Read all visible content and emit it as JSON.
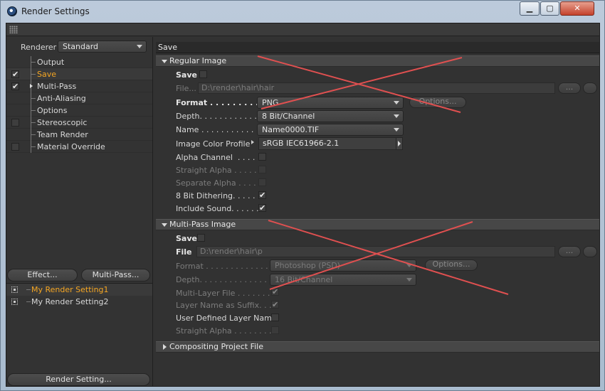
{
  "window": {
    "title": "Render Settings",
    "min_label": "▁",
    "max_label": "▢",
    "close_label": "✕"
  },
  "renderer": {
    "label": "Renderer",
    "value": "Standard"
  },
  "tree": [
    {
      "label": "Output",
      "checkbox": false,
      "checked": false,
      "selected": false
    },
    {
      "label": "Save",
      "checkbox": true,
      "checked": true,
      "selected": true
    },
    {
      "label": "Multi-Pass",
      "checkbox": true,
      "checked": true,
      "selected": false
    },
    {
      "label": "Anti-Aliasing",
      "checkbox": false,
      "checked": false,
      "selected": false
    },
    {
      "label": "Options",
      "checkbox": false,
      "checked": false,
      "selected": false
    },
    {
      "label": "Stereoscopic",
      "checkbox": true,
      "checked": false,
      "selected": false
    },
    {
      "label": "Team Render",
      "checkbox": false,
      "checked": false,
      "selected": false
    },
    {
      "label": "Material Override",
      "checkbox": true,
      "checked": false,
      "selected": false
    }
  ],
  "buttons": {
    "effect": "Effect...",
    "multipass": "Multi-Pass...",
    "render_setting": "Render Setting..."
  },
  "presets": [
    {
      "label": "My Render Setting1",
      "active": true
    },
    {
      "label": "My Render Setting2",
      "active": false
    }
  ],
  "panel": {
    "title": "Save"
  },
  "regular": {
    "title": "Regular Image",
    "save_label": "Save",
    "file_label": "File...",
    "file_value": "D:\\render\\hair\\hair",
    "dots_btn": "...",
    "format_label": "Format . . . . . . . . . . . . .",
    "format_value": "PNG",
    "options_btn": "Options...",
    "depth_label": "Depth. . . . . . . . . . . . . . .",
    "depth_value": "8 Bit/Channel",
    "name_label": "Name . . . . . . . . . . . . . . .",
    "name_value": "Name0000.TIF",
    "profile_label": "Image Color Profile",
    "profile_value": "sRGB IEC61966-2.1",
    "alpha_label": "Alpha Channel  . . . . .",
    "straight_label": "Straight Alpha . . . . . .",
    "separate_label": "Separate Alpha . . . . .",
    "dither_label": "8 Bit Dithering. . . . . .",
    "sound_label": "Include Sound. . . . . . .",
    "checks": {
      "save": false,
      "alpha": false,
      "straight": false,
      "separate": false,
      "dither": true,
      "sound": true
    }
  },
  "multipass": {
    "title": "Multi-Pass Image",
    "save_label": "Save",
    "file_label": "File",
    "file_value": "D:\\render\\hair\\p",
    "dots_btn": "...",
    "format_label": "Format . . . . . . . . . . . . . . .",
    "format_value": "Photoshop (PSD)",
    "options_btn": "Options...",
    "depth_label": "Depth. . . . . . . . . . . . . . . . .",
    "depth_value": "16 Bit/Channel",
    "multilayer_label": "Multi-Layer File . . . . . . . .",
    "suffix_label": "Layer Name as Suffix. . . .",
    "userdef_label": "User Defined Layer Name",
    "straight_label": "Straight Alpha . . . . . . . . .",
    "checks": {
      "save": false,
      "multilayer": true,
      "suffix": true,
      "userdef": false,
      "straight": false
    }
  },
  "compositing": {
    "title": "Compositing Project File"
  },
  "annotation": {
    "color": "#e05050"
  }
}
